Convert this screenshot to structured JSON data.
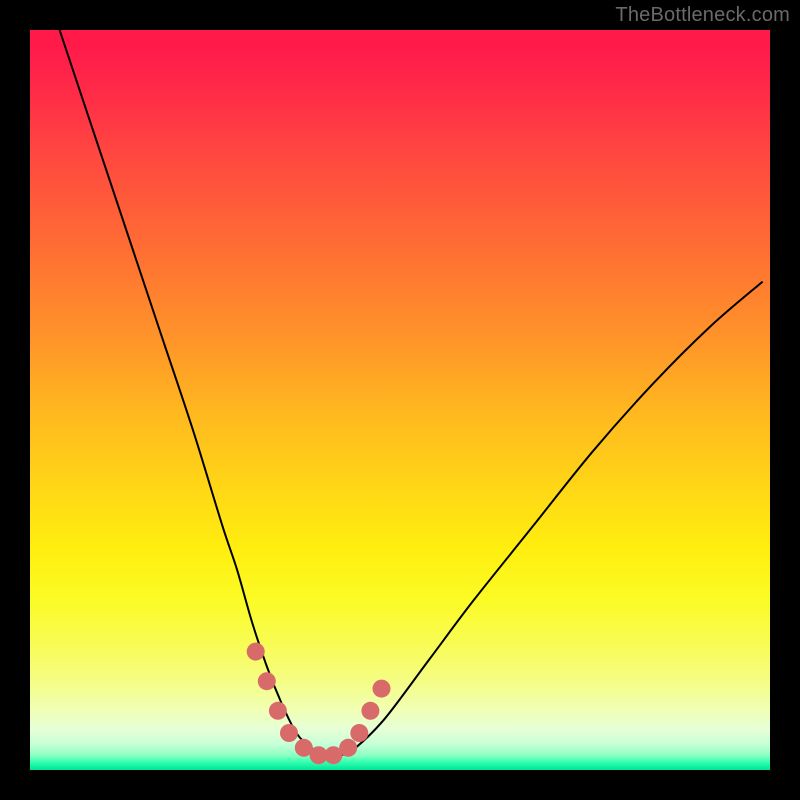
{
  "watermark": "TheBottleneck.com",
  "colors": {
    "frame": "#000000",
    "curve_stroke": "#000000",
    "marker_fill": "#d96a6a",
    "marker_stroke": "#d96a6a",
    "gradient_top": "#ff1a4a",
    "gradient_bottom": "#00e39a"
  },
  "chart_data": {
    "type": "line",
    "title": "",
    "xlabel": "",
    "ylabel": "",
    "xlim": [
      0,
      100
    ],
    "ylim": [
      0,
      100
    ],
    "grid": false,
    "legend": false,
    "series": [
      {
        "name": "bottleneck-curve",
        "x": [
          4,
          6,
          10,
          14,
          18,
          22,
          26,
          28,
          30,
          32,
          34,
          36,
          38,
          40,
          42,
          44,
          48,
          54,
          60,
          68,
          76,
          84,
          92,
          99
        ],
        "y": [
          100,
          94,
          82,
          70,
          58,
          46,
          33,
          27,
          20,
          14,
          9,
          5,
          3,
          2,
          2,
          3,
          7,
          15,
          23,
          33,
          43,
          52,
          60,
          66
        ]
      }
    ],
    "markers": {
      "name": "highlight-points",
      "x": [
        30.5,
        32,
        33.5,
        35,
        37,
        39,
        41,
        43,
        44.5,
        46,
        47.5
      ],
      "y": [
        16,
        12,
        8,
        5,
        3,
        2,
        2,
        3,
        5,
        8,
        11
      ]
    }
  }
}
